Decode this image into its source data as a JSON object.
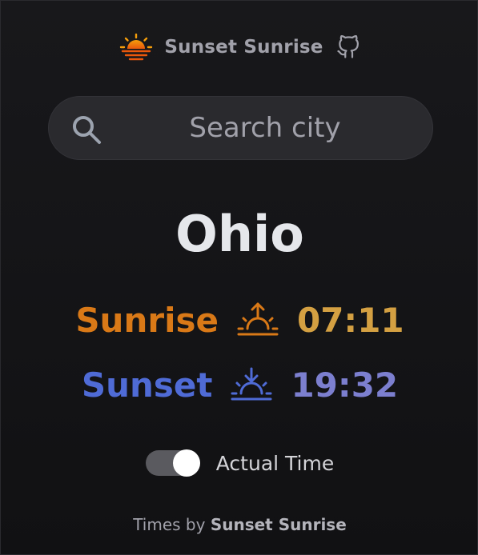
{
  "header": {
    "brand": "Sunset Sunrise",
    "logo_icon": "sun-horizon-icon",
    "github_icon": "github-icon"
  },
  "search": {
    "placeholder": "Search city",
    "value": "",
    "icon": "search-icon"
  },
  "location": {
    "city": "Ohio"
  },
  "times": {
    "sunrise": {
      "label": "Sunrise",
      "icon": "sunrise-icon",
      "time": "07:11"
    },
    "sunset": {
      "label": "Sunset",
      "icon": "sunset-icon",
      "time": "19:32"
    }
  },
  "toggle": {
    "label": "Actual Time",
    "checked": true
  },
  "footer": {
    "prefix": "Times by",
    "source": "Sunset Sunrise"
  },
  "colors": {
    "background": "#141416",
    "sunrise_label": "#d97917",
    "sunrise_time": "#d4a042",
    "sunset_label": "#4f6bd6",
    "sunset_time": "#7c7fcf",
    "logo_top": "#f59e0b",
    "logo_bottom": "#ea580c"
  }
}
